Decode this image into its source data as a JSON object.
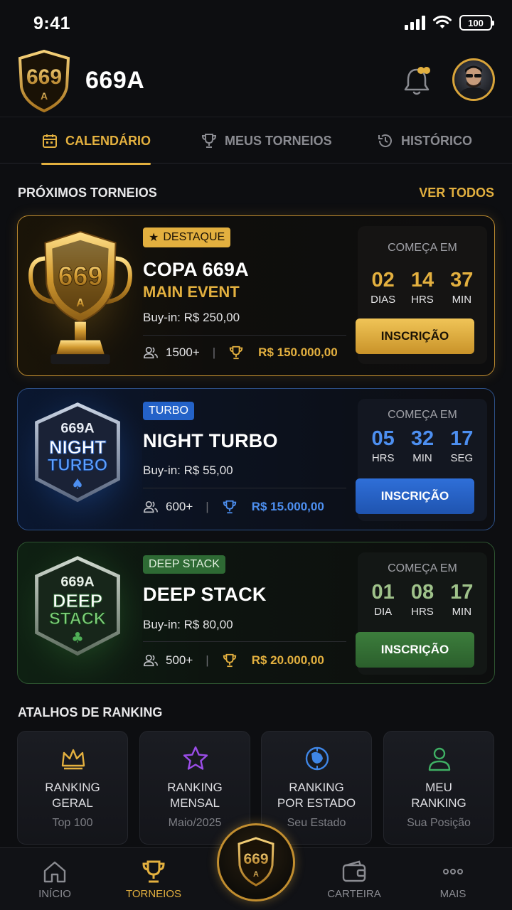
{
  "status_bar": {
    "time": "9:41",
    "battery": "100"
  },
  "header": {
    "title": "669A",
    "logo_text": "669",
    "logo_sub": "A"
  },
  "tabs": [
    {
      "label": "CALENDÁRIO",
      "icon": "calendar-icon",
      "active": true
    },
    {
      "label": "MEUS TORNEIOS",
      "icon": "trophy-icon",
      "active": false
    },
    {
      "label": "HISTÓRICO",
      "icon": "history-icon",
      "active": false
    }
  ],
  "upcoming": {
    "title": "PRÓXIMOS TORNEIOS",
    "see_all": "VER TODOS"
  },
  "tournaments": [
    {
      "badge": "DESTAQUE",
      "title": "COPA 669A",
      "subtitle": "MAIN EVENT",
      "buyin": "Buy-in: R$ 250,00",
      "players": "1500+",
      "prize": "R$ 150.000,00",
      "starts_label": "COMEÇA EM",
      "countdown": [
        {
          "value": "02",
          "unit": "DIAS"
        },
        {
          "value": "14",
          "unit": "HRS"
        },
        {
          "value": "37",
          "unit": "MIN"
        }
      ],
      "button": "INSCRIÇÃO",
      "art_top": "669",
      "art_sub": "A"
    },
    {
      "badge": "TURBO",
      "title": "NIGHT TURBO",
      "buyin": "Buy-in: R$ 55,00",
      "players": "600+",
      "prize": "R$ 15.000,00",
      "starts_label": "COMEÇA EM",
      "countdown": [
        {
          "value": "05",
          "unit": "HRS"
        },
        {
          "value": "32",
          "unit": "MIN"
        },
        {
          "value": "17",
          "unit": "SEG"
        }
      ],
      "button": "INSCRIÇÃO",
      "art_top": "669A",
      "art_line1": "NIGHT",
      "art_line2": "TURBO"
    },
    {
      "badge": "DEEP STACK",
      "title": "DEEP STACK",
      "buyin": "Buy-in: R$ 80,00",
      "players": "500+",
      "prize": "R$ 20.000,00",
      "starts_label": "COMEÇA EM",
      "countdown": [
        {
          "value": "01",
          "unit": "DIA"
        },
        {
          "value": "08",
          "unit": "HRS"
        },
        {
          "value": "17",
          "unit": "MIN"
        }
      ],
      "button": "INSCRIÇÃO",
      "art_top": "669A",
      "art_line1": "DEEP",
      "art_line2": "STACK"
    }
  ],
  "ranking": {
    "title": "ATALHOS DE RANKING",
    "items": [
      {
        "line1": "RANKING",
        "line2": "GERAL",
        "sub": "Top 100",
        "icon": "crown-icon",
        "color": "#e3b03f"
      },
      {
        "line1": "RANKING",
        "line2": "MENSAL",
        "sub": "Maio/2025",
        "icon": "star-icon",
        "color": "#9b4de8"
      },
      {
        "line1": "RANKING",
        "line2": "POR ESTADO",
        "sub": "Seu Estado",
        "icon": "map-icon",
        "color": "#3f86e6"
      },
      {
        "line1": "MEU",
        "line2": "RANKING",
        "sub": "Sua Posição",
        "icon": "user-icon",
        "color": "#3fb064"
      }
    ]
  },
  "bottom_nav": [
    {
      "label": "INÍCIO",
      "icon": "home-icon",
      "active": false
    },
    {
      "label": "TORNEIOS",
      "icon": "trophy-icon",
      "active": true
    },
    {
      "label": "CARTEIRA",
      "icon": "wallet-icon",
      "active": false
    },
    {
      "label": "MAIS",
      "icon": "more-icon",
      "active": false
    }
  ],
  "colors": {
    "gold": "#e3b03f",
    "blue": "#4d8ff0",
    "green": "#9fc28a",
    "background": "#0d0e11"
  }
}
